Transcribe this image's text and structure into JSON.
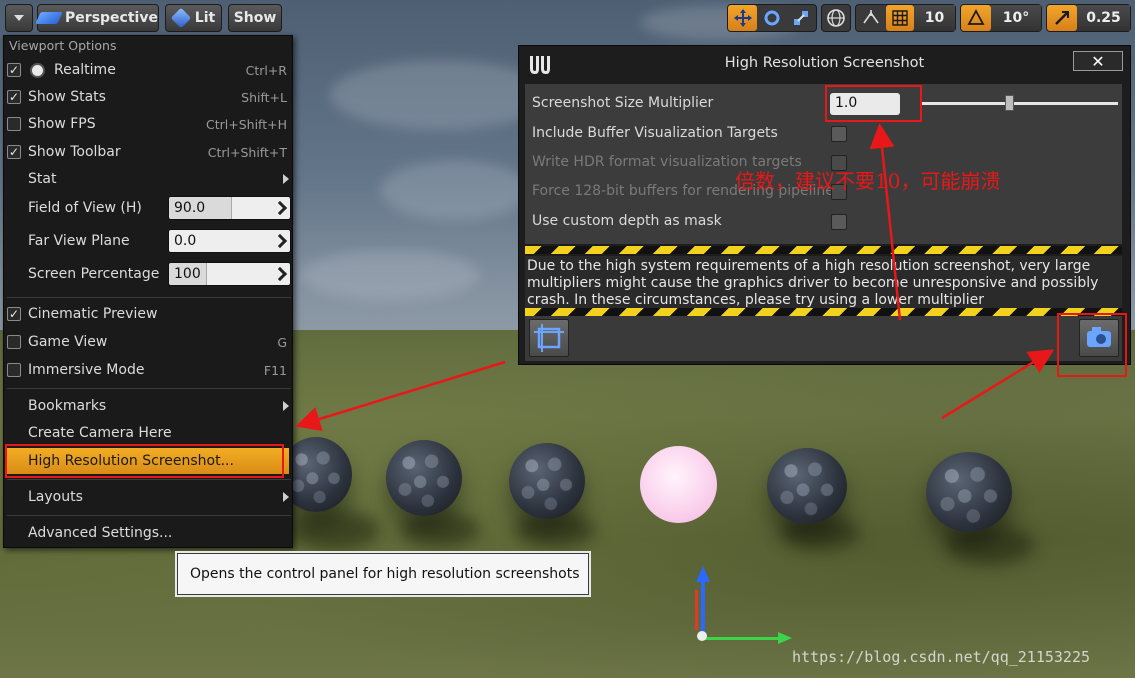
{
  "toolbar": {
    "perspective_label": "Perspective",
    "lit_label": "Lit",
    "show_label": "Show",
    "grid_snap_value": "10",
    "rotation_snap_value": "10°",
    "scale_snap_value": "0.25"
  },
  "viewport_menu": {
    "header": "Viewport Options",
    "realtime": {
      "label": "Realtime",
      "shortcut": "Ctrl+R",
      "checked": true
    },
    "show_stats": {
      "label": "Show Stats",
      "shortcut": "Shift+L",
      "checked": true
    },
    "show_fps": {
      "label": "Show FPS",
      "shortcut": "Ctrl+Shift+H",
      "checked": false
    },
    "show_toolbar": {
      "label": "Show Toolbar",
      "shortcut": "Ctrl+Shift+T",
      "checked": true
    },
    "stat": {
      "label": "Stat"
    },
    "field_of_view": {
      "label": "Field of View (H)",
      "value": "90.0"
    },
    "far_view_plane": {
      "label": "Far View Plane",
      "value": "0.0"
    },
    "screen_percentage": {
      "label": "Screen Percentage",
      "value": "100"
    },
    "cinematic_preview": {
      "label": "Cinematic Preview",
      "checked": true
    },
    "game_view": {
      "label": "Game View",
      "shortcut": "G",
      "checked": false
    },
    "immersive_mode": {
      "label": "Immersive Mode",
      "shortcut": "F11",
      "checked": false
    },
    "bookmarks": {
      "label": "Bookmarks"
    },
    "create_camera": {
      "label": "Create Camera Here"
    },
    "high_res_screenshot": {
      "label": "High Resolution Screenshot..."
    },
    "layouts": {
      "label": "Layouts"
    },
    "advanced_settings": {
      "label": "Advanced Settings..."
    }
  },
  "tooltip": {
    "text": "Opens the control panel for high resolution screenshots"
  },
  "dialog": {
    "title": "High Resolution Screenshot",
    "close_label": "✕",
    "size_multiplier": {
      "label": "Screenshot Size Multiplier",
      "value": "1.0",
      "slider_fraction": 0.45
    },
    "include_buffer": {
      "label": "Include Buffer Visualization Targets"
    },
    "write_hdr": {
      "label": "Write HDR format visualization targets"
    },
    "force_128": {
      "label": "Force 128-bit buffers for rendering pipeline"
    },
    "custom_depth": {
      "label": "Use custom depth as mask"
    },
    "warning": "Due to the high system requirements of a high resolution screenshot, very large multipliers might cause the graphics driver to become unresponsive and possibly crash. In these circumstances, please try using a lower multiplier"
  },
  "annotation_cn": "倍数，建议不要10，可能崩溃",
  "watermark": "https://blog.csdn.net/qq_21153225",
  "colors": {
    "accent_orange": "#f3ad23",
    "annotation_red": "#e81818",
    "selection_blue": "#2a68ff"
  }
}
